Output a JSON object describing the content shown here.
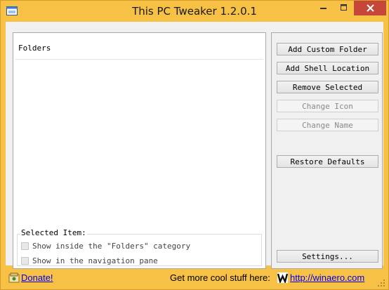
{
  "window": {
    "title": "This PC Tweaker 1.2.0.1",
    "frame_color": "#f7c145",
    "close_color": "#c7463a",
    "icons": {
      "app": "app-window-icon",
      "minimize": "minimize-icon",
      "maximize": "maximize-icon",
      "close": "close-icon"
    }
  },
  "folders": {
    "column_header": "Folders",
    "items": []
  },
  "selected_item": {
    "legend": "Selected Item:",
    "options": [
      {
        "label": "Show inside the \"Folders\" category",
        "checked": false,
        "enabled": false
      },
      {
        "label": "Show in the navigation pane",
        "checked": false,
        "enabled": false
      }
    ]
  },
  "actions": {
    "add_custom_folder": "Add Custom Folder",
    "add_shell_location": "Add Shell Location",
    "remove_selected": "Remove Selected",
    "change_icon": "Change Icon",
    "change_name": "Change Name",
    "restore_defaults": "Restore Defaults",
    "settings": "Settings..."
  },
  "footer": {
    "donate_label": "Donate!",
    "more_text": "Get more cool stuff here:",
    "site_link": "http://winaero.com",
    "link_color": "#0000ee",
    "icons": {
      "donate": "donate-icon",
      "brand": "winaero-logo-icon",
      "grip": "resize-grip-icon"
    }
  }
}
